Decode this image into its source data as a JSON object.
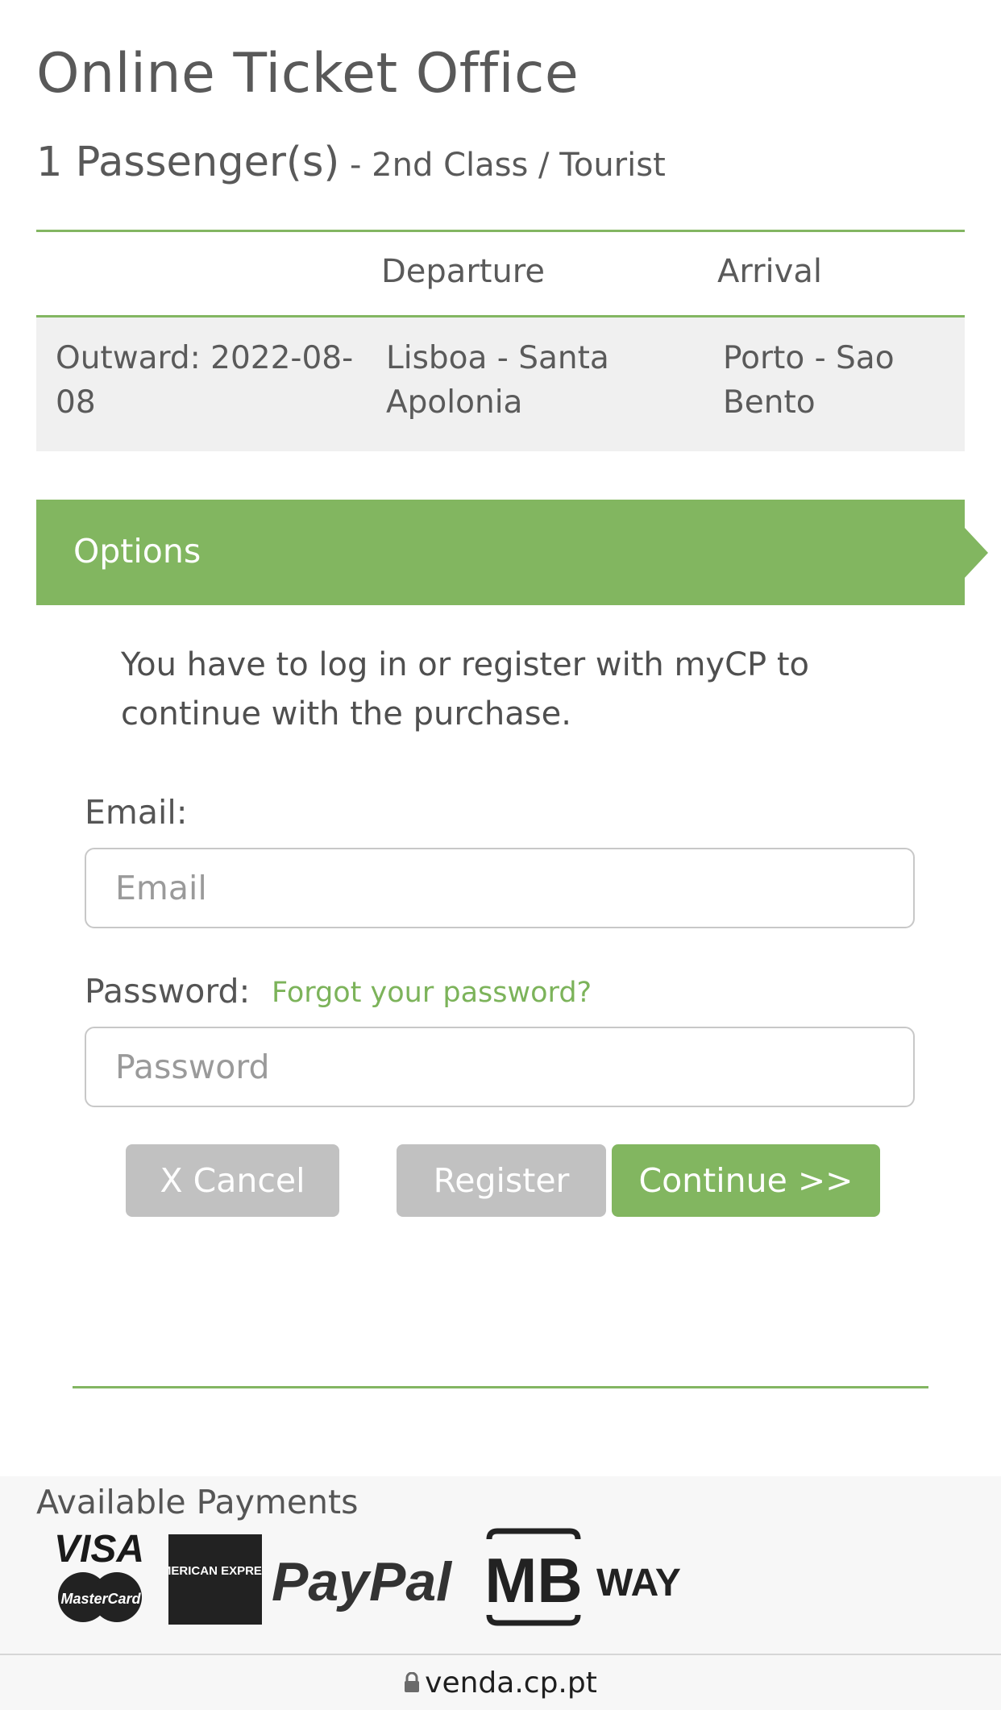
{
  "header": {
    "title": "Online Ticket Office",
    "passengers": "1 Passenger(s)",
    "travel_class": " - 2nd Class / Tourist"
  },
  "trip": {
    "columns": [
      "",
      "Departure",
      "Arrival"
    ],
    "rows": [
      {
        "label": "Outward: 2022-08-08",
        "departure": "Lisboa - Santa Apolonia",
        "arrival": "Porto - Sao Bento"
      }
    ]
  },
  "options": {
    "title": "Options",
    "notice": "You have to log in or register with myCP to continue with the purchase."
  },
  "login": {
    "email_label": "Email:",
    "email_placeholder": "Email",
    "email_value": "",
    "password_label": "Password:",
    "password_placeholder": "Password",
    "password_value": "",
    "forgot_link": "Forgot your password?"
  },
  "actions": {
    "cancel": "X Cancel",
    "register": "Register",
    "continue": "Continue >>"
  },
  "payments": {
    "title": "Available Payments",
    "logos": [
      "VISA",
      "MasterCard",
      "AMERICAN EXPRESS",
      "PayPal",
      "MB",
      "WAY"
    ]
  },
  "browser": {
    "url": "venda.cp.pt"
  },
  "colors": {
    "accent": "#82b660",
    "button_disabled": "#c1c1c1",
    "row_background": "#f0f0f0"
  }
}
